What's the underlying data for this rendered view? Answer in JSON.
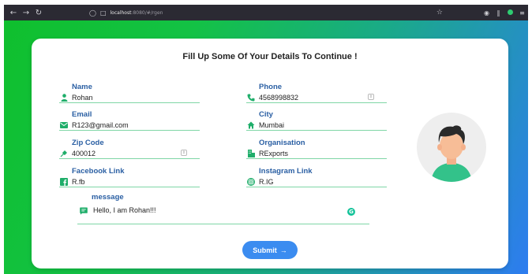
{
  "browser": {
    "url_host": "localhost",
    "url_rest": ":8080/#/rgen"
  },
  "form": {
    "title": "Fill Up Some Of Your Details To Continue !",
    "fields": [
      {
        "label": "Name",
        "value": "Rohan"
      },
      {
        "label": "Phone",
        "value": "4568998832"
      },
      {
        "label": "Email",
        "value": "R123@gmail.com"
      },
      {
        "label": "City",
        "value": "Mumbai"
      },
      {
        "label": "Zip Code",
        "value": "400012"
      },
      {
        "label": "Organisation",
        "value": "RExports"
      },
      {
        "label": "Facebook Link",
        "value": "R.fb"
      },
      {
        "label": "Instagram Link",
        "value": "R.IG"
      }
    ],
    "message": {
      "label": "message",
      "value": "Hello, I am Rohan!!!"
    },
    "submit_label": "Submit",
    "accent_color": "#2a5fa3",
    "button_color": "#3b8cf0",
    "icon_color": "#1fae6a"
  },
  "icons": [
    "back-icon",
    "forward-icon",
    "reload-icon",
    "shield-icon",
    "page-icon",
    "star-icon",
    "pocket-icon",
    "library-icon",
    "extension-icon",
    "menu-icon",
    "user-icon",
    "phone-icon",
    "email-icon",
    "home-icon",
    "pin-icon",
    "building-icon",
    "facebook-icon",
    "instagram-icon",
    "message-icon",
    "grammarly-icon",
    "arrow-right-icon"
  ]
}
